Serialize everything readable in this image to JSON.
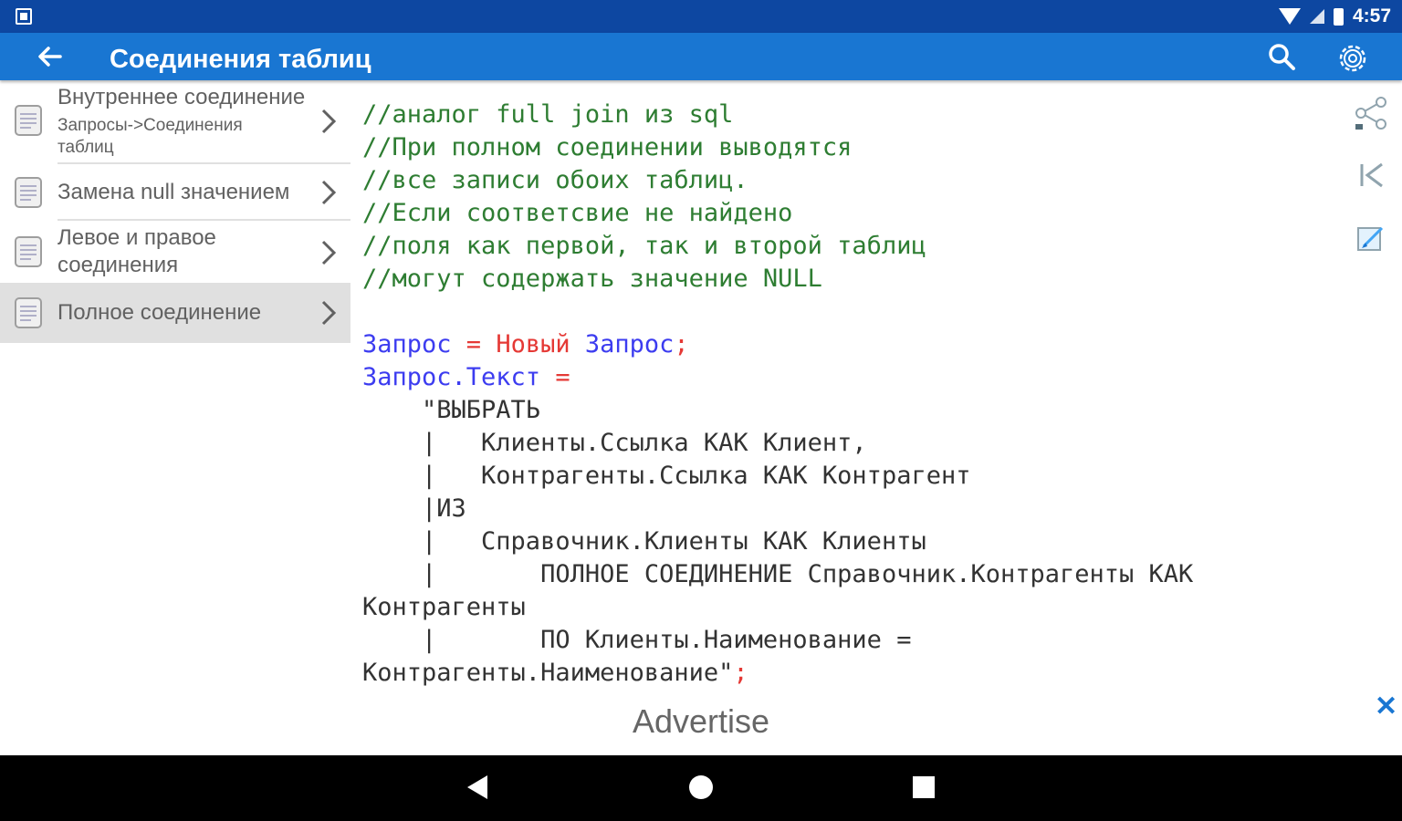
{
  "status_bar": {
    "time": "4:57"
  },
  "app_bar": {
    "title": "Соединения таблиц"
  },
  "sidebar": {
    "items": [
      {
        "label": "Внутреннее соединение",
        "sub": "Запросы->Соединения таблиц",
        "selected": false
      },
      {
        "label": "Замена null значением",
        "sub": "",
        "selected": false
      },
      {
        "label": "Левое и правое соединения",
        "sub": "",
        "selected": false
      },
      {
        "label": "Полное соединение",
        "sub": "",
        "selected": true
      }
    ]
  },
  "code": {
    "lines": [
      [
        {
          "t": "//аналог full join из sql",
          "c": "cmt"
        }
      ],
      [
        {
          "t": "//При полном соединении выводятся",
          "c": "cmt"
        }
      ],
      [
        {
          "t": "//все записи обоих таблиц.",
          "c": "cmt"
        }
      ],
      [
        {
          "t": "//Если соответсвие не найдено",
          "c": "cmt"
        }
      ],
      [
        {
          "t": "//поля как первой, так и второй таблиц",
          "c": "cmt"
        }
      ],
      [
        {
          "t": "//могут содержать значение NULL",
          "c": "cmt"
        }
      ],
      [],
      [
        {
          "t": "Запрос",
          "c": "kw"
        },
        {
          "t": " = ",
          "c": "red"
        },
        {
          "t": "Новый",
          "c": "red"
        },
        {
          "t": " Запрос",
          "c": "kw"
        },
        {
          "t": ";",
          "c": "red"
        }
      ],
      [
        {
          "t": "Запрос.Текст",
          "c": "kw"
        },
        {
          "t": " =",
          "c": "red"
        }
      ],
      [
        {
          "t": "    \"ВЫБРАТЬ",
          "c": "mono"
        }
      ],
      [
        {
          "t": "    |   Клиенты.Ссылка КАК Клиент,",
          "c": "mono"
        }
      ],
      [
        {
          "t": "    |   Контрагенты.Ссылка КАК Контрагент",
          "c": "mono"
        }
      ],
      [
        {
          "t": "    |ИЗ",
          "c": "mono"
        }
      ],
      [
        {
          "t": "    |   Справочник.Клиенты КАК Клиенты",
          "c": "mono"
        }
      ],
      [
        {
          "t": "    |       ПОЛНОЕ СОЕДИНЕНИЕ Справочник.Контрагенты КАК",
          "c": "mono"
        }
      ],
      [
        {
          "t": "Контрагенты",
          "c": "mono"
        }
      ],
      [
        {
          "t": "    |       ПО Клиенты.Наименование =",
          "c": "mono"
        }
      ],
      [
        {
          "t": "Контрагенты.Наименование\"",
          "c": "mono"
        },
        {
          "t": ";",
          "c": "red"
        }
      ]
    ]
  },
  "ad": {
    "text": "Advertise",
    "close": "✕"
  },
  "icons": {
    "back": "arrow-left-icon",
    "search": "search-icon",
    "settings": "gear-icon",
    "share": "share-icon",
    "first": "skip-first-icon",
    "edit": "edit-icon"
  },
  "colors": {
    "status_bar": "#0d47a1",
    "app_bar": "#1976d2",
    "comment": "#2e7d32",
    "keyword": "#3c3cf0",
    "operator": "#e53935"
  }
}
